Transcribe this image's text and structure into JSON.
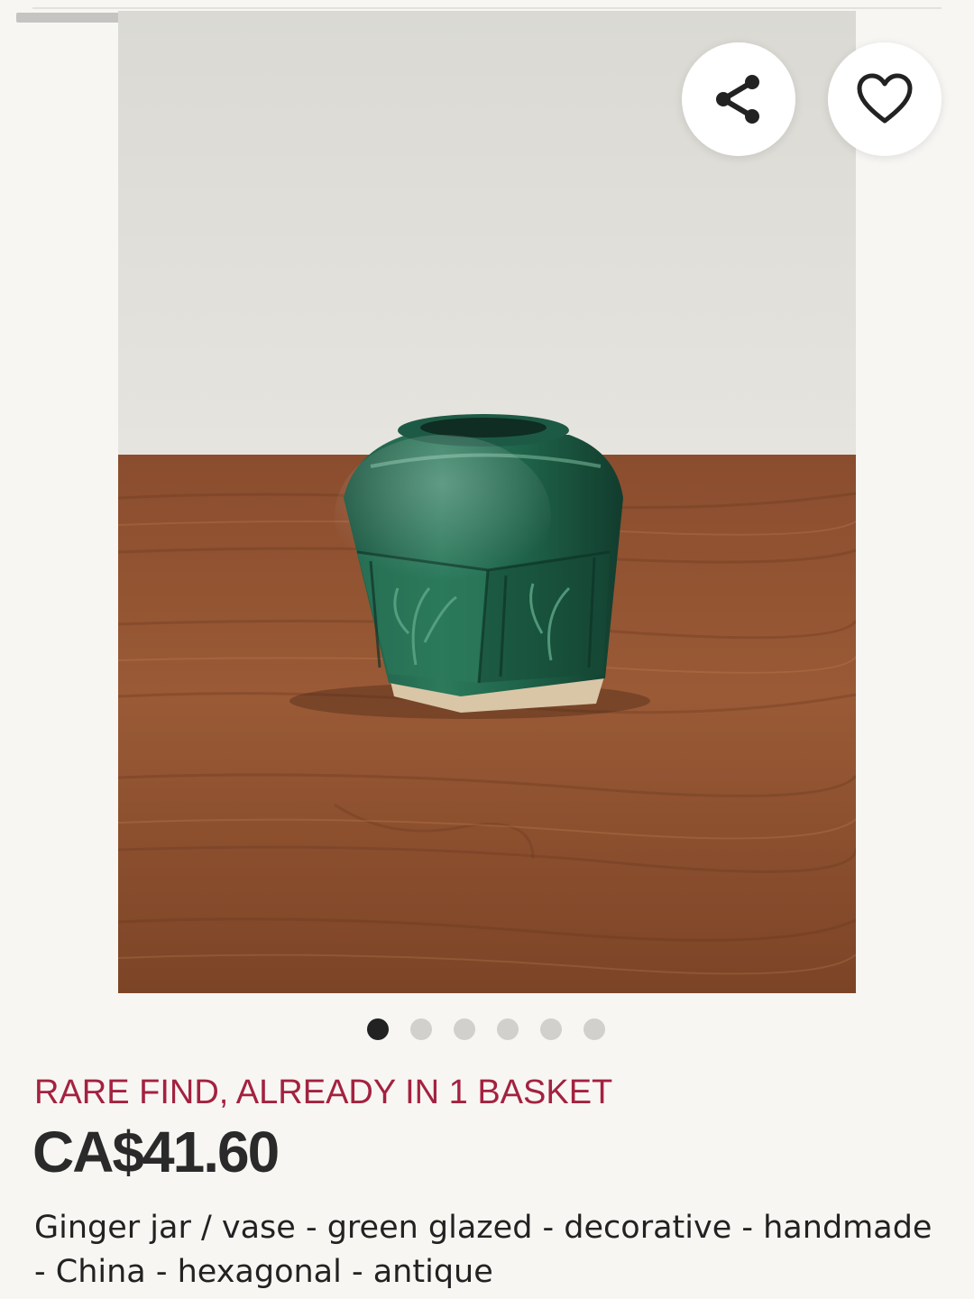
{
  "listing": {
    "urgency_text": "RARE FIND, ALREADY IN 1 BASKET",
    "price": "CA$41.60",
    "title": "Ginger jar / vase - green glazed - decorative - handmade - China - hexagonal - antique"
  },
  "gallery": {
    "image_count": 6,
    "active_index": 0
  },
  "actions": {
    "share_icon": "share-icon",
    "favorite_icon": "heart-outline-icon"
  },
  "colors": {
    "accent_urgency": "#a3223f",
    "text_primary": "#222222",
    "background": "#f7f6f3",
    "dot_active": "#222222",
    "dot_inactive": "#d2d0cc"
  }
}
